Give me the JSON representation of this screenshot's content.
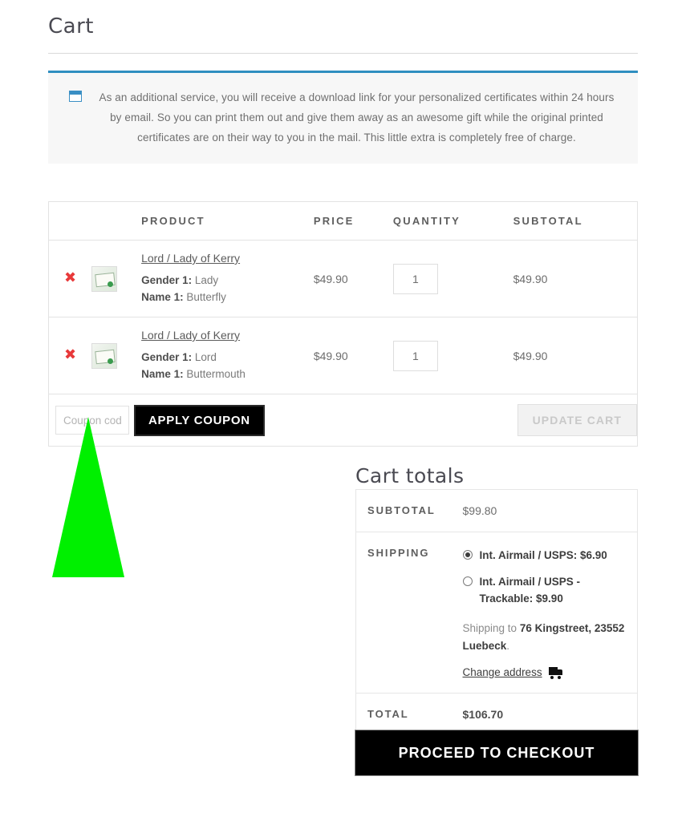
{
  "page": {
    "title": "Cart"
  },
  "notice": {
    "icon": "certificate-window-icon",
    "text": "As an additional service, you will receive a download link for your personalized certificates within 24 hours by email. So you can print them out and give them away as an awesome gift while the original printed certificates are on their way to you in the mail. This little extra is completely free of charge.",
    "accent_color": "#2f8ec0",
    "background_color": "#f7f7f7"
  },
  "cart_table": {
    "columns": [
      "",
      "",
      "PRODUCT",
      "PRICE",
      "QUANTITY",
      "SUBTOTAL"
    ],
    "headers": {
      "product": "PRODUCT",
      "price": "PRICE",
      "quantity": "QUANTITY",
      "subtotal": "SUBTOTAL"
    },
    "remove_glyph": "✖",
    "rows": [
      {
        "name": "Lord / Lady of Kerry",
        "meta": [
          {
            "label": "Gender 1:",
            "value": "Lady"
          },
          {
            "label": "Name 1:",
            "value": "Butterfly"
          }
        ],
        "price": "$49.90",
        "quantity": "1",
        "subtotal": "$49.90",
        "thumb": "certificate-thumbnail"
      },
      {
        "name": "Lord / Lady of Kerry",
        "meta": [
          {
            "label": "Gender 1:",
            "value": "Lord"
          },
          {
            "label": "Name 1:",
            "value": "Buttermouth"
          }
        ],
        "price": "$49.90",
        "quantity": "1",
        "subtotal": "$49.90",
        "thumb": "certificate-thumbnail"
      }
    ]
  },
  "coupon": {
    "placeholder": "Coupon code",
    "value": "",
    "apply_label": "APPLY COUPON",
    "update_label": "UPDATE CART",
    "update_disabled": true
  },
  "totals": {
    "title": "Cart totals",
    "subtotal_label": "SUBTOTAL",
    "subtotal_value": "$99.80",
    "shipping_label": "SHIPPING",
    "shipping_options": [
      {
        "label": "Int. Airmail / USPS: $6.90",
        "selected": true
      },
      {
        "label": "Int. Airmail / USPS - Trackable: $9.90",
        "selected": false
      }
    ],
    "shipping_to_prefix": "Shipping to ",
    "shipping_address": "76 Kingstreet, 23552 Luebeck",
    "shipping_to_suffix": ".",
    "change_address_label": "Change address",
    "change_address_icon": "delivery-truck-icon",
    "total_label": "TOTAL",
    "total_value": "$106.70"
  },
  "checkout": {
    "label": "PROCEED TO CHECKOUT"
  },
  "annotation": {
    "pointer": "green-pointer-triangle",
    "color": "#00f000"
  }
}
